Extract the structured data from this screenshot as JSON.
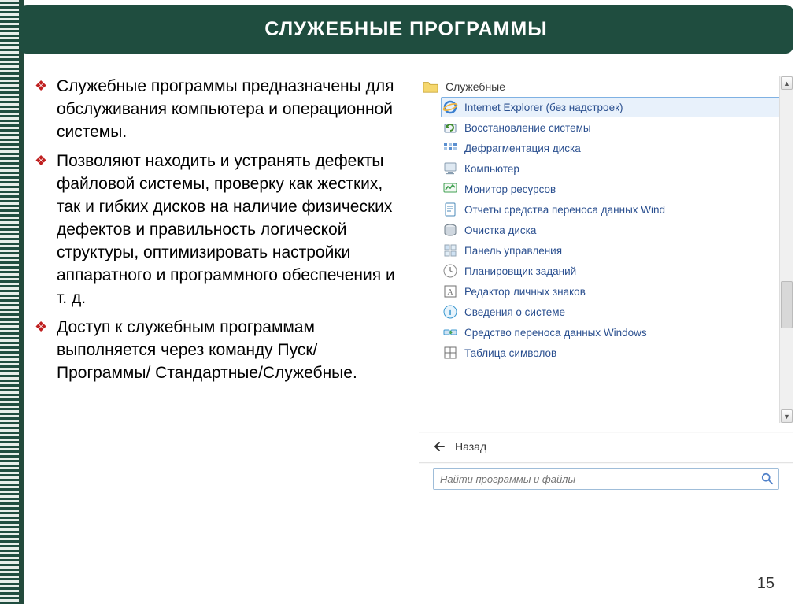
{
  "header": {
    "title": "СЛУЖЕБНЫЕ ПРОГРАММЫ"
  },
  "bullets": [
    "Служебные программы предназначены для обслуживания компьютера и операционной системы.",
    "Позволяют находить и устранять дефекты файловой системы, проверку как жестких, так и гибких дисков на наличие физических дефектов и правильность логической структуры, оптимизировать настройки аппаратного и программного обеспечения и т. д.",
    "Доступ к служебным программам выполняется через команду Пуск/Программы/ Стандартные/Служебные."
  ],
  "menu": {
    "folder_label": "Служебные",
    "items": [
      {
        "label": "Internet Explorer (без надстроек)",
        "selected": true,
        "icon": "ie"
      },
      {
        "label": "Восстановление системы",
        "icon": "restore"
      },
      {
        "label": "Дефрагментация диска",
        "icon": "defrag"
      },
      {
        "label": "Компьютер",
        "icon": "computer"
      },
      {
        "label": "Монитор ресурсов",
        "icon": "monitor"
      },
      {
        "label": "Отчеты средства переноса данных Wind",
        "icon": "report"
      },
      {
        "label": "Очистка диска",
        "icon": "diskclean"
      },
      {
        "label": "Панель управления",
        "icon": "cpl"
      },
      {
        "label": "Планировщик заданий",
        "icon": "scheduler"
      },
      {
        "label": "Редактор личных знаков",
        "icon": "charedit"
      },
      {
        "label": "Сведения о системе",
        "icon": "sysinfo"
      },
      {
        "label": "Средство переноса данных Windows",
        "icon": "transfer"
      },
      {
        "label": "Таблица символов",
        "icon": "chartable"
      }
    ],
    "back_label": "Назад",
    "search_placeholder": "Найти программы и файлы"
  },
  "page_number": "15",
  "icon_colors": {
    "ie": {
      "bg": "#ffffff",
      "fg": "#3a7fd0"
    },
    "restore": {
      "bg": "#ffffff",
      "fg": "#418c2e"
    },
    "defrag": {
      "bg": "#ffffff",
      "fg": "#5a8fcf"
    },
    "computer": {
      "bg": "#ffffff",
      "fg": "#889db0"
    },
    "monitor": {
      "bg": "#ffffff",
      "fg": "#3fa050"
    },
    "report": {
      "bg": "#ffffff",
      "fg": "#4b8ab8"
    },
    "diskclean": {
      "bg": "#ffffff",
      "fg": "#6f7d88"
    },
    "cpl": {
      "bg": "#ffffff",
      "fg": "#97a7b5"
    },
    "scheduler": {
      "bg": "#ffffff",
      "fg": "#8b8b8b"
    },
    "charedit": {
      "bg": "#ffffff",
      "fg": "#6f6f6f"
    },
    "sysinfo": {
      "bg": "#ffffff",
      "fg": "#3c99d0"
    },
    "transfer": {
      "bg": "#ffffff",
      "fg": "#3c99d0"
    },
    "chartable": {
      "bg": "#ffffff",
      "fg": "#6f6f6f"
    }
  }
}
